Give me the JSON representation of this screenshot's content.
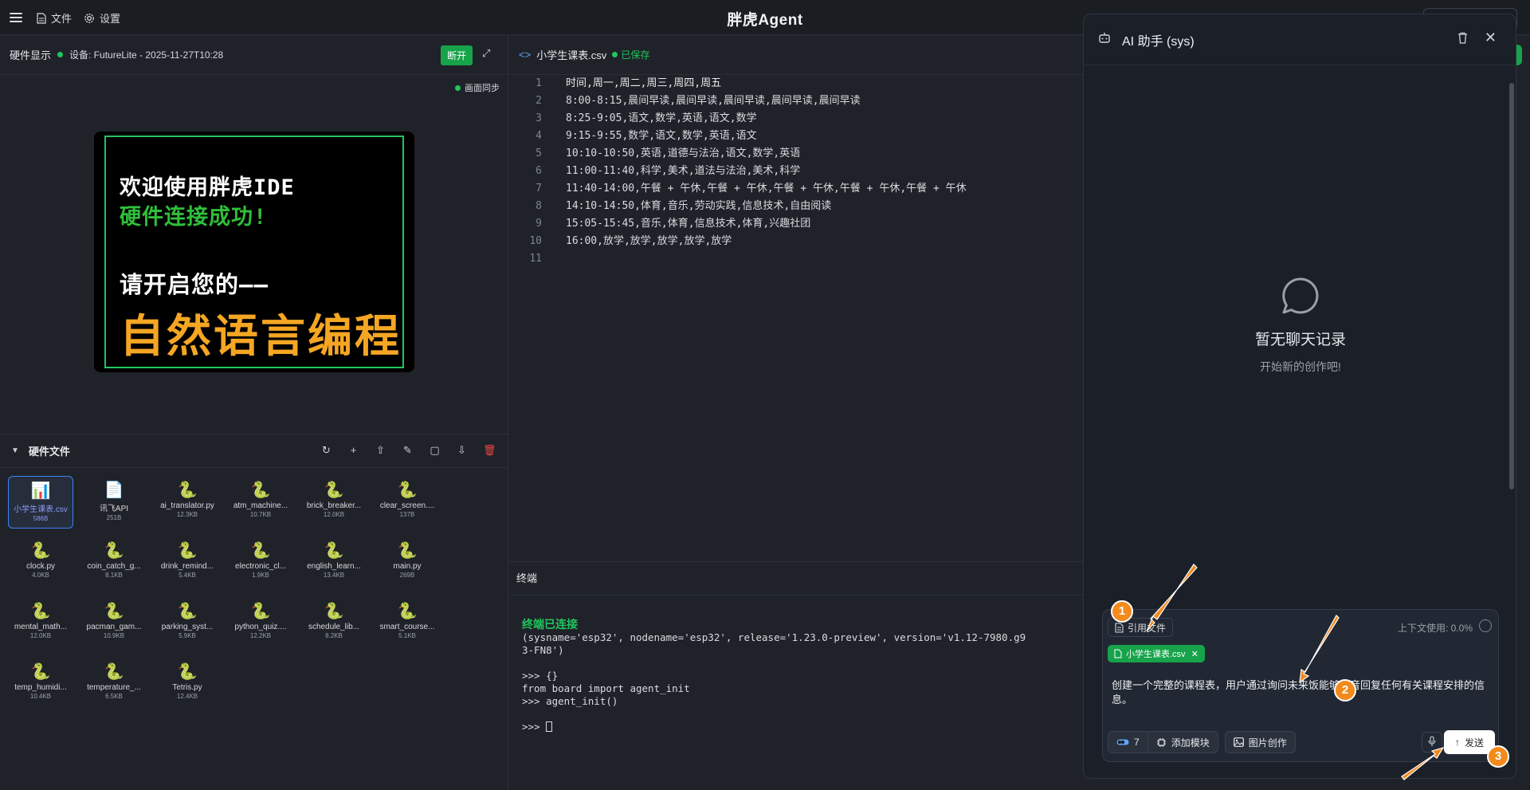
{
  "topbar": {
    "file_label": "文件",
    "settings_label": "设置",
    "app_title": "胖虎Agent"
  },
  "hardware": {
    "title": "硬件显示",
    "device": "设备: FutureLite - 2025-11-27T10:28",
    "disconnect_label": "断开",
    "sync_label": "画面同步",
    "screen": {
      "line1": "欢迎使用胖虎IDE",
      "line2": "硬件连接成功!",
      "line3": "请开启您的——",
      "line4": "自然语言编程"
    }
  },
  "files": {
    "title": "硬件文件",
    "items": [
      {
        "name": "小学生课表.csv",
        "size": "586B",
        "icon": "chart-icon"
      },
      {
        "name": "讯飞API",
        "size": "251B",
        "icon": "document-icon"
      },
      {
        "name": "ai_translator.py",
        "size": "12.3KB",
        "icon": "python-icon"
      },
      {
        "name": "atm_machine...",
        "size": "10.7KB",
        "icon": "python-icon"
      },
      {
        "name": "brick_breaker...",
        "size": "12.0KB",
        "icon": "python-icon"
      },
      {
        "name": "clear_screen....",
        "size": "137B",
        "icon": "python-icon"
      },
      {
        "name": "clock.py",
        "size": "4.0KB",
        "icon": "python-icon"
      },
      {
        "name": "coin_catch_g...",
        "size": "8.1KB",
        "icon": "python-icon"
      },
      {
        "name": "drink_remind...",
        "size": "5.4KB",
        "icon": "python-icon"
      },
      {
        "name": "electronic_cl...",
        "size": "1.9KB",
        "icon": "python-icon"
      },
      {
        "name": "english_learn...",
        "size": "13.4KB",
        "icon": "python-icon"
      },
      {
        "name": "main.py",
        "size": "269B",
        "icon": "python-icon"
      },
      {
        "name": "mental_math...",
        "size": "12.0KB",
        "icon": "python-icon"
      },
      {
        "name": "pacman_gam...",
        "size": "10.9KB",
        "icon": "python-icon"
      },
      {
        "name": "parking_syst...",
        "size": "5.9KB",
        "icon": "python-icon"
      },
      {
        "name": "python_quiz....",
        "size": "12.2KB",
        "icon": "python-icon"
      },
      {
        "name": "schedule_lib...",
        "size": "8.2KB",
        "icon": "python-icon"
      },
      {
        "name": "smart_course...",
        "size": "5.1KB",
        "icon": "python-icon"
      },
      {
        "name": "temp_humidi...",
        "size": "10.4KB",
        "icon": "python-icon"
      },
      {
        "name": "temperature_...",
        "size": "6.5KB",
        "icon": "python-icon"
      },
      {
        "name": "Tetris.py",
        "size": "12.4KB",
        "icon": "python-icon"
      }
    ]
  },
  "editor": {
    "tab_name": "小学生课表.csv",
    "saved_label": "已保存",
    "lines": [
      "时间,周一,周二,周三,周四,周五",
      "8:00-8:15,晨间早读,晨间早读,晨间早读,晨间早读,晨间早读",
      "8:25-9:05,语文,数学,英语,语文,数学",
      "9:15-9:55,数学,语文,数学,英语,语文",
      "10:10-10:50,英语,道德与法治,语文,数学,英语",
      "11:00-11:40,科学,美术,道法与法治,美术,科学",
      "11:40-14:00,午餐 + 午休,午餐 + 午休,午餐 + 午休,午餐 + 午休,午餐 + 午休",
      "14:10-14:50,体育,音乐,劳动实践,信息技术,自由阅读",
      "15:05-15:45,音乐,体育,信息技术,体育,兴趣社团",
      "16:00,放学,放学,放学,放学,放学",
      ""
    ]
  },
  "terminal": {
    "title": "终端",
    "connected": "终端已连接",
    "lines": [
      "(sysname='esp32', nodename='esp32', release='1.23.0-preview', version='v1.12-7980.g9",
      "3-FN8')",
      "",
      ">>> {}",
      "from board import agent_init",
      ">>> agent_init()"
    ],
    "prompt": ">>> "
  },
  "ai": {
    "title": "AI 助手 (sys)",
    "empty_title": "暂无聊天记录",
    "empty_sub": "开始新的创作吧!",
    "ref_file_label": "引用文件",
    "context_usage": "上下文使用: 0.0%",
    "attached_file": "小学生课表.csv",
    "prompt_text": "创建一个完整的课程表，用户通过询问未来饭能够语音回复任何有关课程安排的信息。",
    "module_count": "7",
    "add_module_label": "添加模块",
    "image_create_label": "图片创作",
    "send_label": "发送"
  },
  "annotations": {
    "badge1": "1",
    "badge2": "2",
    "badge3": "3",
    "color": "#f28a1c"
  }
}
